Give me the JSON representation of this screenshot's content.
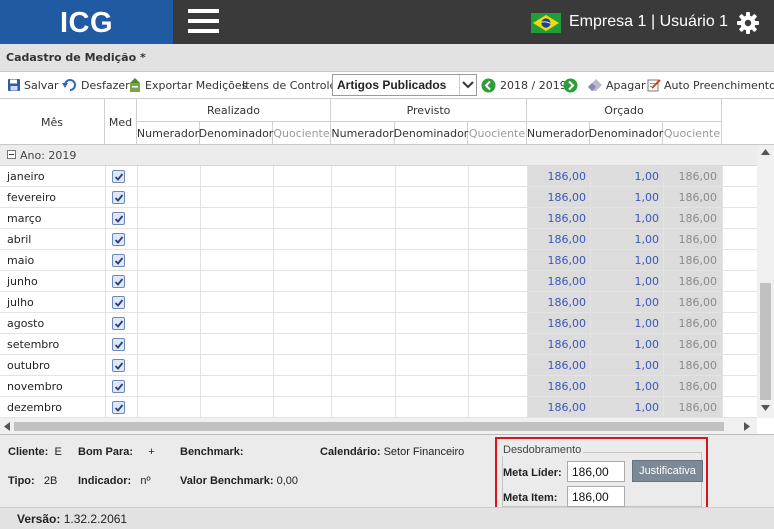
{
  "header": {
    "logo": "ICG",
    "company": "Empresa 1",
    "user": "| Usuário 1"
  },
  "page_title": "Cadastro de Medição *",
  "toolbar": {
    "save": "Salvar",
    "undo": "Desfazer",
    "export": "Exportar Medições",
    "control_items_label": "Itens de Controle:",
    "control_items_value": "Artigos Publicados",
    "period": "2018 / 2019",
    "delete": "Apagar",
    "autofill": "Auto Preenchimento"
  },
  "grid": {
    "col_mes": "Mês",
    "col_med": "Med",
    "groups": [
      "Realizado",
      "Previsto",
      "Orçado"
    ],
    "sub_cols": [
      "Numerador",
      "Denominador",
      "Quociente"
    ],
    "year_group": "Ano: 2019",
    "rows": [
      {
        "mes": "janeiro",
        "num": "186,00",
        "den": "1,00",
        "quo": "186,00"
      },
      {
        "mes": "fevereiro",
        "num": "186,00",
        "den": "1,00",
        "quo": "186,00"
      },
      {
        "mes": "março",
        "num": "186,00",
        "den": "1,00",
        "quo": "186,00"
      },
      {
        "mes": "abril",
        "num": "186,00",
        "den": "1,00",
        "quo": "186,00"
      },
      {
        "mes": "maio",
        "num": "186,00",
        "den": "1,00",
        "quo": "186,00"
      },
      {
        "mes": "junho",
        "num": "186,00",
        "den": "1,00",
        "quo": "186,00"
      },
      {
        "mes": "julho",
        "num": "186,00",
        "den": "1,00",
        "quo": "186,00"
      },
      {
        "mes": "agosto",
        "num": "186,00",
        "den": "1,00",
        "quo": "186,00"
      },
      {
        "mes": "setembro",
        "num": "186,00",
        "den": "1,00",
        "quo": "186,00"
      },
      {
        "mes": "outubro",
        "num": "186,00",
        "den": "1,00",
        "quo": "186,00"
      },
      {
        "mes": "novembro",
        "num": "186,00",
        "den": "1,00",
        "quo": "186,00"
      },
      {
        "mes": "dezembro",
        "num": "186,00",
        "den": "1,00",
        "quo": "186,00"
      }
    ]
  },
  "info": {
    "cliente_label": "Cliente:",
    "cliente_value": "E",
    "bom_para_label": "Bom Para:",
    "bom_para_value": "+",
    "benchmark_label": "Benchmark:",
    "calendario_label": "Calendário:",
    "calendario_value": "Setor Financeiro",
    "tipo_label": "Tipo:",
    "tipo_value": "2B",
    "indicador_label": "Indicador:",
    "indicador_value": "nº",
    "valor_benchmark_label": "Valor Benchmark:",
    "valor_benchmark_value": "0,00"
  },
  "desdobramento": {
    "legend": "Desdobramento",
    "meta_lider_label": "Meta Líder:",
    "meta_lider_value": "186,00",
    "meta_item_label": "Meta Item:",
    "meta_item_value": "186,00",
    "justificativa": "Justificativa"
  },
  "footer": {
    "version_label": "Versão:",
    "version_value": "1.32.2.2061"
  },
  "colors": {
    "logo_bg": "#1f5aa3",
    "header_bg": "#3a3a3a",
    "highlight_border": "#d9151b",
    "value_blue": "#3a56b8"
  }
}
